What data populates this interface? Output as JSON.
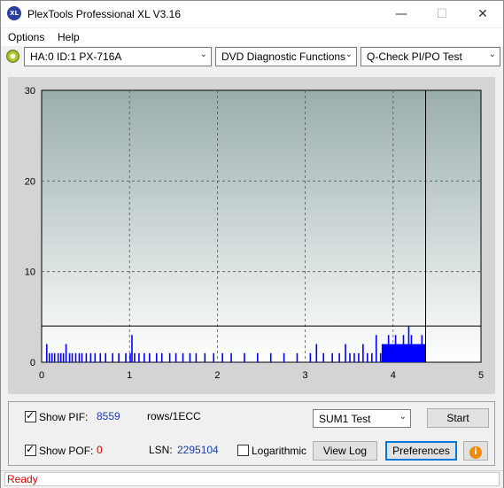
{
  "window": {
    "title": "PlexTools Professional XL V3.16",
    "app_icon_text": "XL",
    "min": "—",
    "max": "☐",
    "close": "✕"
  },
  "menu": {
    "options": "Options",
    "help": "Help"
  },
  "toolbar": {
    "drive": "HA:0 ID:1  PX-716A",
    "function": "DVD Diagnostic Functions",
    "test": "Q-Check PI/PO Test"
  },
  "chart_data": {
    "type": "bar",
    "x_ticks": [
      "0",
      "1",
      "2",
      "3",
      "4",
      "5"
    ],
    "y_ticks": [
      "0",
      "10",
      "20",
      "30"
    ],
    "xlim": [
      0,
      5
    ],
    "ylim": [
      0,
      30
    ],
    "grid": true,
    "threshold_line": 4,
    "end_marker_x": 4.37,
    "series": [
      {
        "color": "#0000ff",
        "x": [
          0.05,
          0.08,
          0.11,
          0.14,
          0.18,
          0.21,
          0.24,
          0.27,
          0.31,
          0.34,
          0.38,
          0.42,
          0.45,
          0.5,
          0.55,
          0.6,
          0.66,
          0.72,
          0.8,
          0.87,
          0.95,
          1.0,
          1.02,
          1.05,
          1.1,
          1.16,
          1.22,
          1.3,
          1.36,
          1.45,
          1.52,
          1.6,
          1.68,
          1.75,
          1.85,
          1.95,
          2.05,
          2.15,
          2.3,
          2.45,
          2.6,
          2.75,
          2.9,
          3.05,
          3.12,
          3.2,
          3.3,
          3.38,
          3.45,
          3.5,
          3.55,
          3.6,
          3.65,
          3.7,
          3.75,
          3.8,
          3.85,
          3.9,
          3.94,
          3.98,
          4.02,
          4.05,
          4.08,
          4.11,
          4.14,
          4.17,
          4.2,
          4.24,
          4.28,
          4.32,
          4.35
        ],
        "values": [
          2,
          1,
          1,
          1,
          1,
          1,
          1,
          2,
          1,
          1,
          1,
          1,
          1,
          1,
          1,
          1,
          1,
          1,
          1,
          1,
          1,
          1,
          3,
          1,
          1,
          1,
          1,
          1,
          1,
          1,
          1,
          1,
          1,
          1,
          1,
          1,
          1,
          1,
          1,
          1,
          1,
          1,
          1,
          1,
          2,
          1,
          1,
          1,
          2,
          1,
          1,
          1,
          2,
          1,
          1,
          3,
          1,
          1,
          3,
          2,
          3,
          2,
          2,
          3,
          2,
          4,
          3,
          2,
          2,
          3,
          2
        ]
      }
    ]
  },
  "bottom": {
    "show_pif": "Show PIF:",
    "pif_value": "8559",
    "pif_unit": "rows/1ECC",
    "show_pof": "Show POF:",
    "pof_value": "0",
    "lsn_label": "LSN:",
    "lsn_value": "2295104",
    "log_label": "Logarithmic",
    "test_select": "SUM1 Test",
    "start": "Start",
    "view_log": "View Log",
    "preferences": "Preferences",
    "info_icon": "i"
  },
  "status": "Ready"
}
